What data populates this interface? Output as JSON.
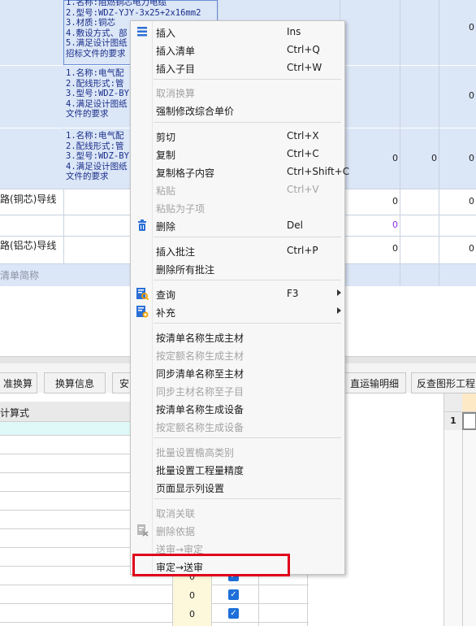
{
  "top_table": {
    "rows": [
      {
        "lines": [
          "1.名称:阻燃铜芯电力电缆",
          "2.型号:WDZ-YJY-3x25+2x16mm2",
          "3.材质:铜芯",
          "4.敷设方式、部",
          "5.满足设计图纸",
          "招标文件的要求"
        ],
        "values": [
          "0"
        ]
      },
      {
        "lines": [
          "1.名称:电气配",
          "2.配线形式:管",
          "3.型号:WDZ-BY",
          "4.满足设计图纸",
          "文件的要求"
        ],
        "values": [
          "0"
        ]
      },
      {
        "lines": [
          "1.名称:电气配",
          "2.配线形式:管",
          "3.型号:WDZ-BY",
          "4.满足设计图纸",
          "文件的要求"
        ],
        "values": [
          "0",
          "0",
          "0"
        ]
      },
      {
        "name": "路(铜芯)导线",
        "values": [
          "0",
          "0"
        ]
      },
      {
        "name": "",
        "values": [
          "0"
        ]
      },
      {
        "name": "路(铝芯)导线",
        "values": [
          "0",
          "0"
        ]
      },
      {
        "name": "清单简称",
        "values": []
      }
    ]
  },
  "tabs": [
    "准换算",
    "换算信息",
    "安",
    "直运输明细",
    "反查图形工程"
  ],
  "lower_grid": {
    "header": "计算式",
    "right_row_number": "1",
    "rows": [
      {
        "value": "0",
        "checked": true
      },
      {
        "value": "0",
        "checked": true
      },
      {
        "value": "0",
        "checked": true
      }
    ]
  },
  "context_menu": {
    "items": [
      {
        "label": "插入",
        "shortcut": "Ins",
        "enabled": true,
        "icon": "list-icon"
      },
      {
        "label": "插入清单",
        "shortcut": "Ctrl+Q",
        "enabled": true
      },
      {
        "label": "插入子目",
        "shortcut": "Ctrl+W",
        "enabled": true
      },
      {
        "label": "取消换算",
        "shortcut": "",
        "enabled": false
      },
      {
        "label": "强制修改综合单价",
        "shortcut": "",
        "enabled": true
      },
      {
        "label": "剪切",
        "shortcut": "Ctrl+X",
        "enabled": true
      },
      {
        "label": "复制",
        "shortcut": "Ctrl+C",
        "enabled": true
      },
      {
        "label": "复制格子内容",
        "shortcut": "Ctrl+Shift+C",
        "enabled": true
      },
      {
        "label": "粘贴",
        "shortcut": "Ctrl+V",
        "enabled": false
      },
      {
        "label": "粘贴为子项",
        "shortcut": "",
        "enabled": false
      },
      {
        "label": "删除",
        "shortcut": "Del",
        "enabled": true,
        "icon": "trash-icon"
      },
      {
        "label": "插入批注",
        "shortcut": "Ctrl+P",
        "enabled": true
      },
      {
        "label": "删除所有批注",
        "shortcut": "",
        "enabled": true
      },
      {
        "label": "查询",
        "shortcut": "F3",
        "enabled": true,
        "icon": "query-icon",
        "submenu": true
      },
      {
        "label": "补充",
        "shortcut": "",
        "enabled": true,
        "icon": "supplement-icon",
        "submenu": true
      },
      {
        "label": "按清单名称生成主材",
        "shortcut": "",
        "enabled": true
      },
      {
        "label": "按定额名称生成主材",
        "shortcut": "",
        "enabled": false
      },
      {
        "label": "同步清单名称至主材",
        "shortcut": "",
        "enabled": true
      },
      {
        "label": "同步主材名称至子目",
        "shortcut": "",
        "enabled": false
      },
      {
        "label": "按清单名称生成设备",
        "shortcut": "",
        "enabled": true
      },
      {
        "label": "按定额名称生成设备",
        "shortcut": "",
        "enabled": false
      },
      {
        "label": "批量设置檐高类别",
        "shortcut": "",
        "enabled": false
      },
      {
        "label": "批量设置工程量精度",
        "shortcut": "",
        "enabled": true
      },
      {
        "label": "页面显示列设置",
        "shortcut": "",
        "enabled": true
      },
      {
        "label": "取消关联",
        "shortcut": "",
        "enabled": false
      },
      {
        "label": "删除依据",
        "shortcut": "",
        "enabled": false,
        "icon": "delete-basis-icon"
      },
      {
        "label": "送审→审定",
        "shortcut": "",
        "enabled": false
      },
      {
        "label": "审定→送审",
        "shortcut": "",
        "enabled": true
      }
    ],
    "highlighted_item": "审定→送审",
    "highlight_color": "#e0001a"
  },
  "colors": {
    "selected_row": "#dbe6f7",
    "accent": "#1e6fd9"
  }
}
